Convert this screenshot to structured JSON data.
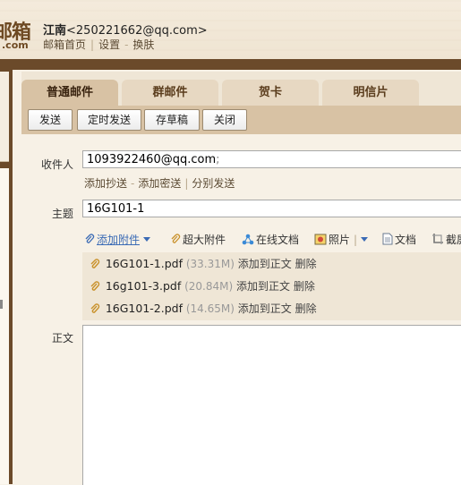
{
  "header": {
    "logo_char": "邮箱",
    "logo_sub": ".com",
    "user_name": "江南",
    "user_email": "<250221662@qq.com>",
    "links": [
      "邮箱首页",
      "设置",
      "换肤"
    ],
    "separator": "|",
    "dash": "-"
  },
  "tabs": [
    {
      "label": "普通邮件",
      "active": true
    },
    {
      "label": "群邮件",
      "active": false
    },
    {
      "label": "贺卡",
      "active": false
    },
    {
      "label": "明信片",
      "active": false
    }
  ],
  "toolbar": {
    "send": "发送",
    "timed_send": "定时发送",
    "save_draft": "存草稿",
    "close": "关闭"
  },
  "compose": {
    "to_label": "收件人",
    "to_value": "1093922460@qq.com",
    "to_semicolon": ";",
    "add_cc": "添加抄送",
    "add_bcc": "添加密送",
    "separate_send": "分别发送",
    "subject_label": "主题",
    "subject_value": "16G101-1",
    "body_label": "正文"
  },
  "attach_tools": {
    "add_attachment": "添加附件",
    "large_attachment": "超大附件",
    "online_doc": "在线文档",
    "photo": "照片",
    "document": "文档",
    "screenshot": "截屏"
  },
  "attachments": [
    {
      "name": "16G101-1.pdf",
      "size": "(33.31M)",
      "add_to_body": "添加到正文",
      "delete": "删除"
    },
    {
      "name": "16g101-3.pdf",
      "size": "(20.84M)",
      "add_to_body": "添加到正文",
      "delete": "删除"
    },
    {
      "name": "16G101-2.pdf",
      "size": "(14.65M)",
      "add_to_body": "添加到正文",
      "delete": "删除"
    }
  ],
  "colors": {
    "frame_brown": "#6b4a2a",
    "tab_active": "#d8c2a4",
    "tab_inactive": "#e7d8c2",
    "link_blue": "#3b6bb5"
  }
}
